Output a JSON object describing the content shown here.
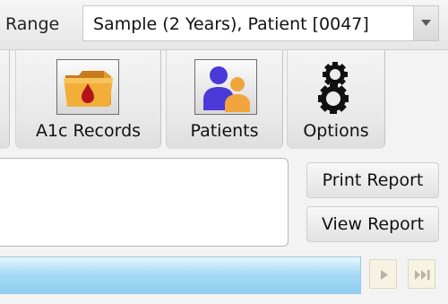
{
  "toolbar": {
    "range_label": "Range",
    "patient_selector": {
      "selected": "Sample (2 Years), Patient [0047]"
    }
  },
  "tabs": [
    {
      "label": "A1c Records",
      "icon": "blood-drop-folder-icon"
    },
    {
      "label": "Patients",
      "icon": "users-icon"
    },
    {
      "label": "Options",
      "icon": "gears-icon"
    }
  ],
  "report": {
    "print_label": "Print Report",
    "view_label": "View Report"
  },
  "navigation": {
    "next_icon": "play-icon",
    "last_icon": "skip-to-end-icon"
  },
  "colors": {
    "progress": "#a9dcf7",
    "folder": "#f1ae39",
    "drop": "#b1151a",
    "user_purple": "#4b39d8",
    "user_orange": "#f2a43d"
  }
}
